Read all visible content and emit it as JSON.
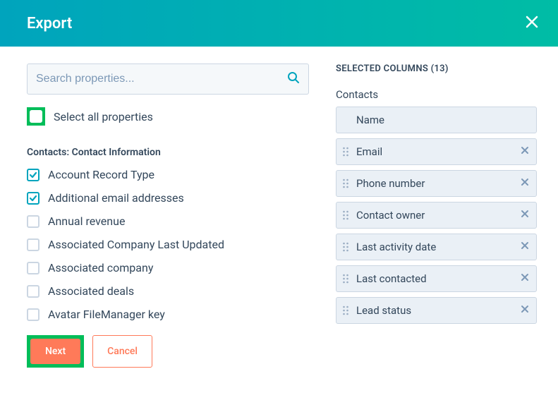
{
  "header": {
    "title": "Export"
  },
  "search": {
    "placeholder": "Search properties..."
  },
  "select_all": {
    "label": "Select all properties"
  },
  "section": {
    "title": "Contacts: Contact Information"
  },
  "properties": [
    {
      "label": "Account Record Type",
      "checked": true
    },
    {
      "label": "Additional email addresses",
      "checked": true
    },
    {
      "label": "Annual revenue",
      "checked": false
    },
    {
      "label": "Associated Company Last Updated",
      "checked": false
    },
    {
      "label": "Associated company",
      "checked": false
    },
    {
      "label": "Associated deals",
      "checked": false
    },
    {
      "label": "Avatar FileManager key",
      "checked": false
    }
  ],
  "buttons": {
    "next": "Next",
    "cancel": "Cancel"
  },
  "selected": {
    "title": "SELECTED COLUMNS (13)",
    "group": "Contacts",
    "columns": [
      {
        "label": "Name",
        "removable": false
      },
      {
        "label": "Email",
        "removable": true
      },
      {
        "label": "Phone number",
        "removable": true
      },
      {
        "label": "Contact owner",
        "removable": true
      },
      {
        "label": "Last activity date",
        "removable": true
      },
      {
        "label": "Last contacted",
        "removable": true
      },
      {
        "label": "Lead status",
        "removable": true
      }
    ]
  }
}
